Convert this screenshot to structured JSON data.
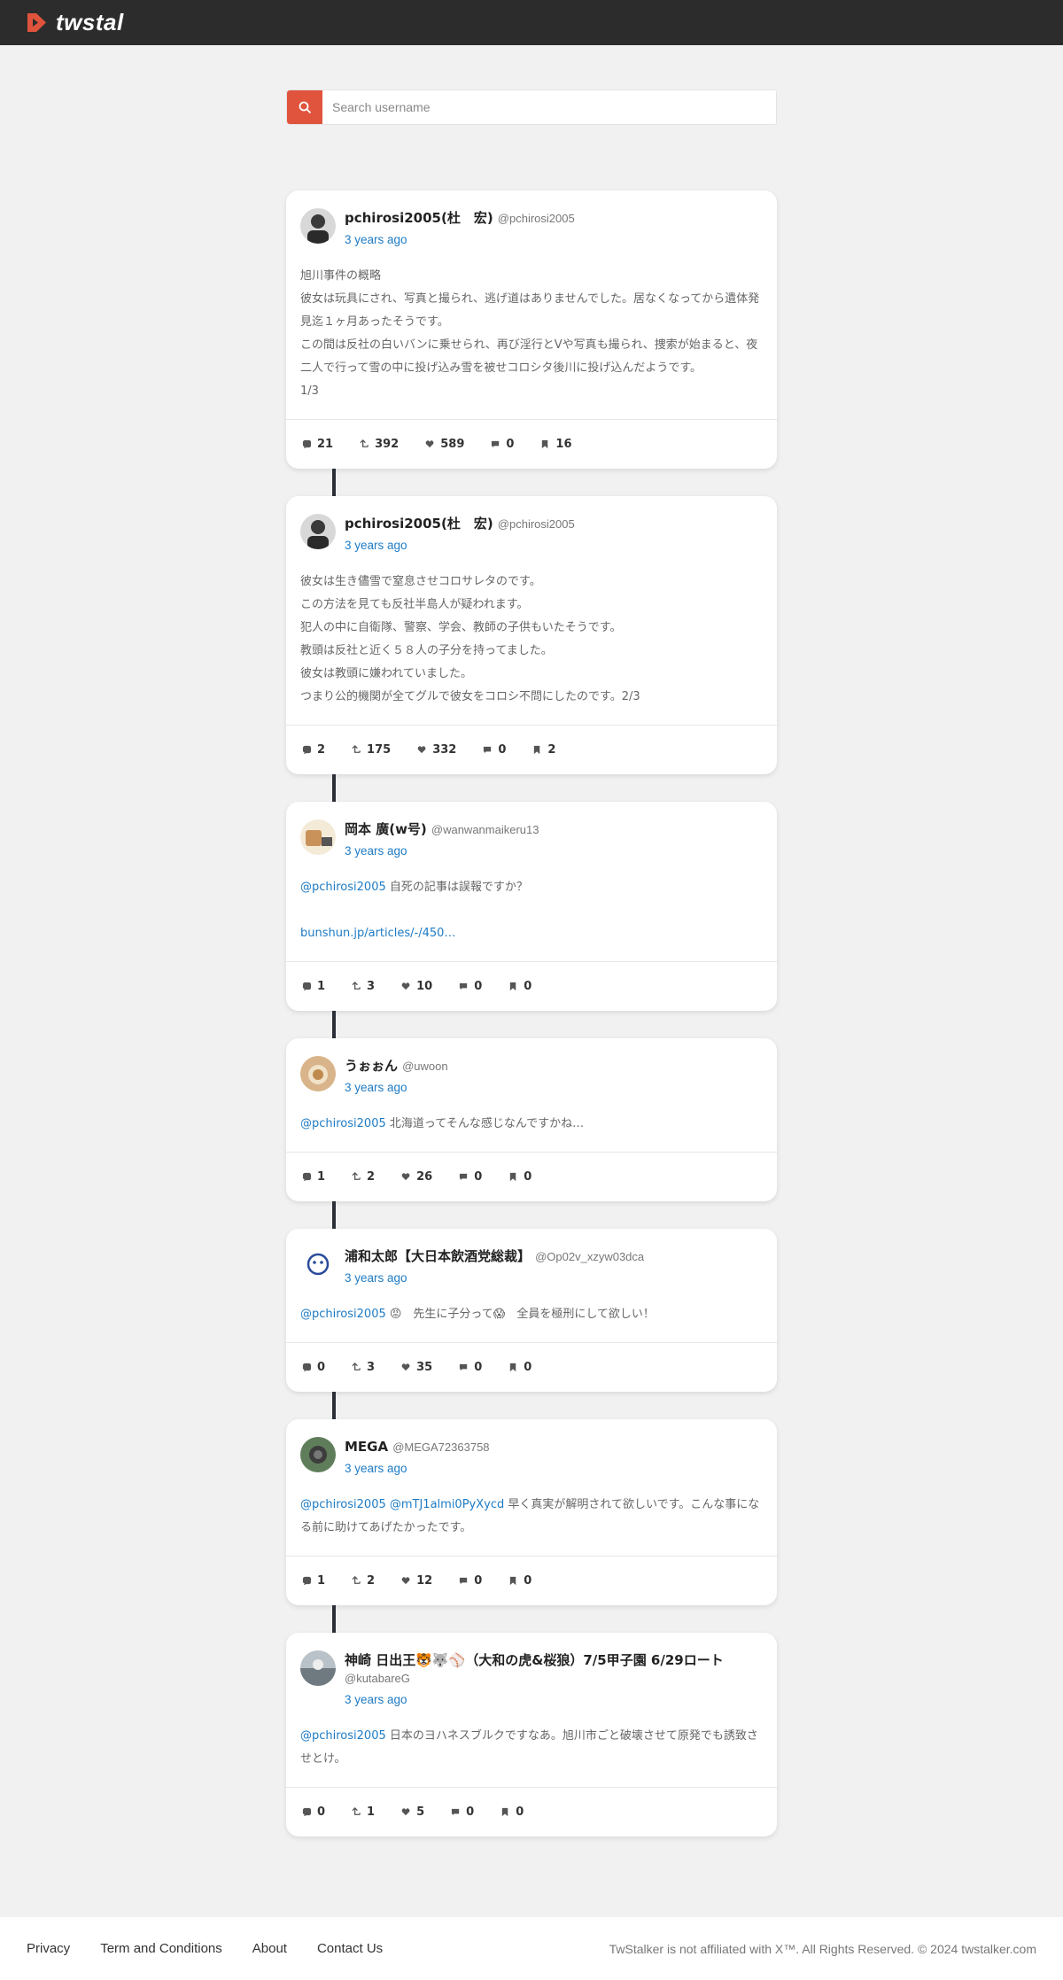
{
  "brand": {
    "name": "twstal",
    "accent": "#e0533d"
  },
  "search": {
    "placeholder": "Search username",
    "icon": "search-icon"
  },
  "tweets": [
    {
      "name": "pchirosi2005(杜　宏)",
      "handle": "@pchirosi2005",
      "time": "3 years ago",
      "lines": [
        "旭川事件の概略",
        "彼女は玩具にされ、写真と撮られ、逃げ道はありませんでした。居なくなってから遺体発見迄１ヶ月あったそうです。",
        "この間は反社の白いバンに乗せられ、再び淫行とVや写真も撮られ、捜索が始まると、夜二人で行って雪の中に投げ込み雪を被せコロシタ後川に投げ込んだようです。",
        "1/3"
      ],
      "stats": {
        "replies": "21",
        "retweets": "392",
        "likes": "589",
        "quotes": "0",
        "bookmarks": "16"
      }
    },
    {
      "name": "pchirosi2005(杜　宏)",
      "handle": "@pchirosi2005",
      "time": "3 years ago",
      "lines": [
        "彼女は生き儘雪で窒息させコロサレタのです。",
        "この方法を見ても反社半島人が疑われます。",
        "犯人の中に自衛隊、警察、学会、教師の子供もいたそうです。",
        "教頭は反社と近く５８人の子分を持ってました。",
        "彼女は教頭に嫌われていました。",
        "つまり公的機関が全てグルで彼女をコロシ不問にしたのです。2/3"
      ],
      "stats": {
        "replies": "2",
        "retweets": "175",
        "likes": "332",
        "quotes": "0",
        "bookmarks": "2"
      }
    },
    {
      "name": "岡本 廣(w号)",
      "handle": "@wanwanmaikeru13",
      "time": "3 years ago",
      "mentions": "@pchirosi2005",
      "text": " 自死の記事は誤報ですか？",
      "link": "bunshun.jp/articles/-/450…",
      "stats": {
        "replies": "1",
        "retweets": "3",
        "likes": "10",
        "quotes": "0",
        "bookmarks": "0"
      }
    },
    {
      "name": "うぉぉん",
      "handle": "@uwoon",
      "time": "3 years ago",
      "mentions": "@pchirosi2005",
      "text": " 北海道ってそんな感じなんですかね…",
      "stats": {
        "replies": "1",
        "retweets": "2",
        "likes": "26",
        "quotes": "0",
        "bookmarks": "0"
      }
    },
    {
      "name": "浦和太郎【大日本飲酒党総裁】",
      "handle": "@Op02v_xzyw03dca",
      "time": "3 years ago",
      "mentions": "@pchirosi2005",
      "text": " 😡　先生に子分って😱　全員を極刑にして欲しい！",
      "stats": {
        "replies": "0",
        "retweets": "3",
        "likes": "35",
        "quotes": "0",
        "bookmarks": "0"
      }
    },
    {
      "name": "MEGA",
      "handle": "@MEGA72363758",
      "time": "3 years ago",
      "mentions": "@pchirosi2005 @mTJ1almi0PyXycd",
      "text": " 早く真実が解明されて欲しいです。こんな事になる前に助けてあげたかったです。",
      "stats": {
        "replies": "1",
        "retweets": "2",
        "likes": "12",
        "quotes": "0",
        "bookmarks": "0"
      }
    },
    {
      "name": "神崎 日出王🐯🐺⚾（大和の虎&桜狼）7/5甲子園 6/29ロート",
      "handle": "@kutabareG",
      "time": "3 years ago",
      "mentions": "@pchirosi2005",
      "text": " 日本のヨハネスブルクですなあ。旭川市ごと破壊させて原発でも誘致させとけ。",
      "stats": {
        "replies": "0",
        "retweets": "1",
        "likes": "5",
        "quotes": "0",
        "bookmarks": "0"
      }
    }
  ],
  "footer": {
    "links": [
      "Privacy",
      "Term and Conditions",
      "About",
      "Contact Us"
    ],
    "note": "TwStalker is not affiliated with X™. All Rights Reserved. © 2024 twstalker.com"
  }
}
